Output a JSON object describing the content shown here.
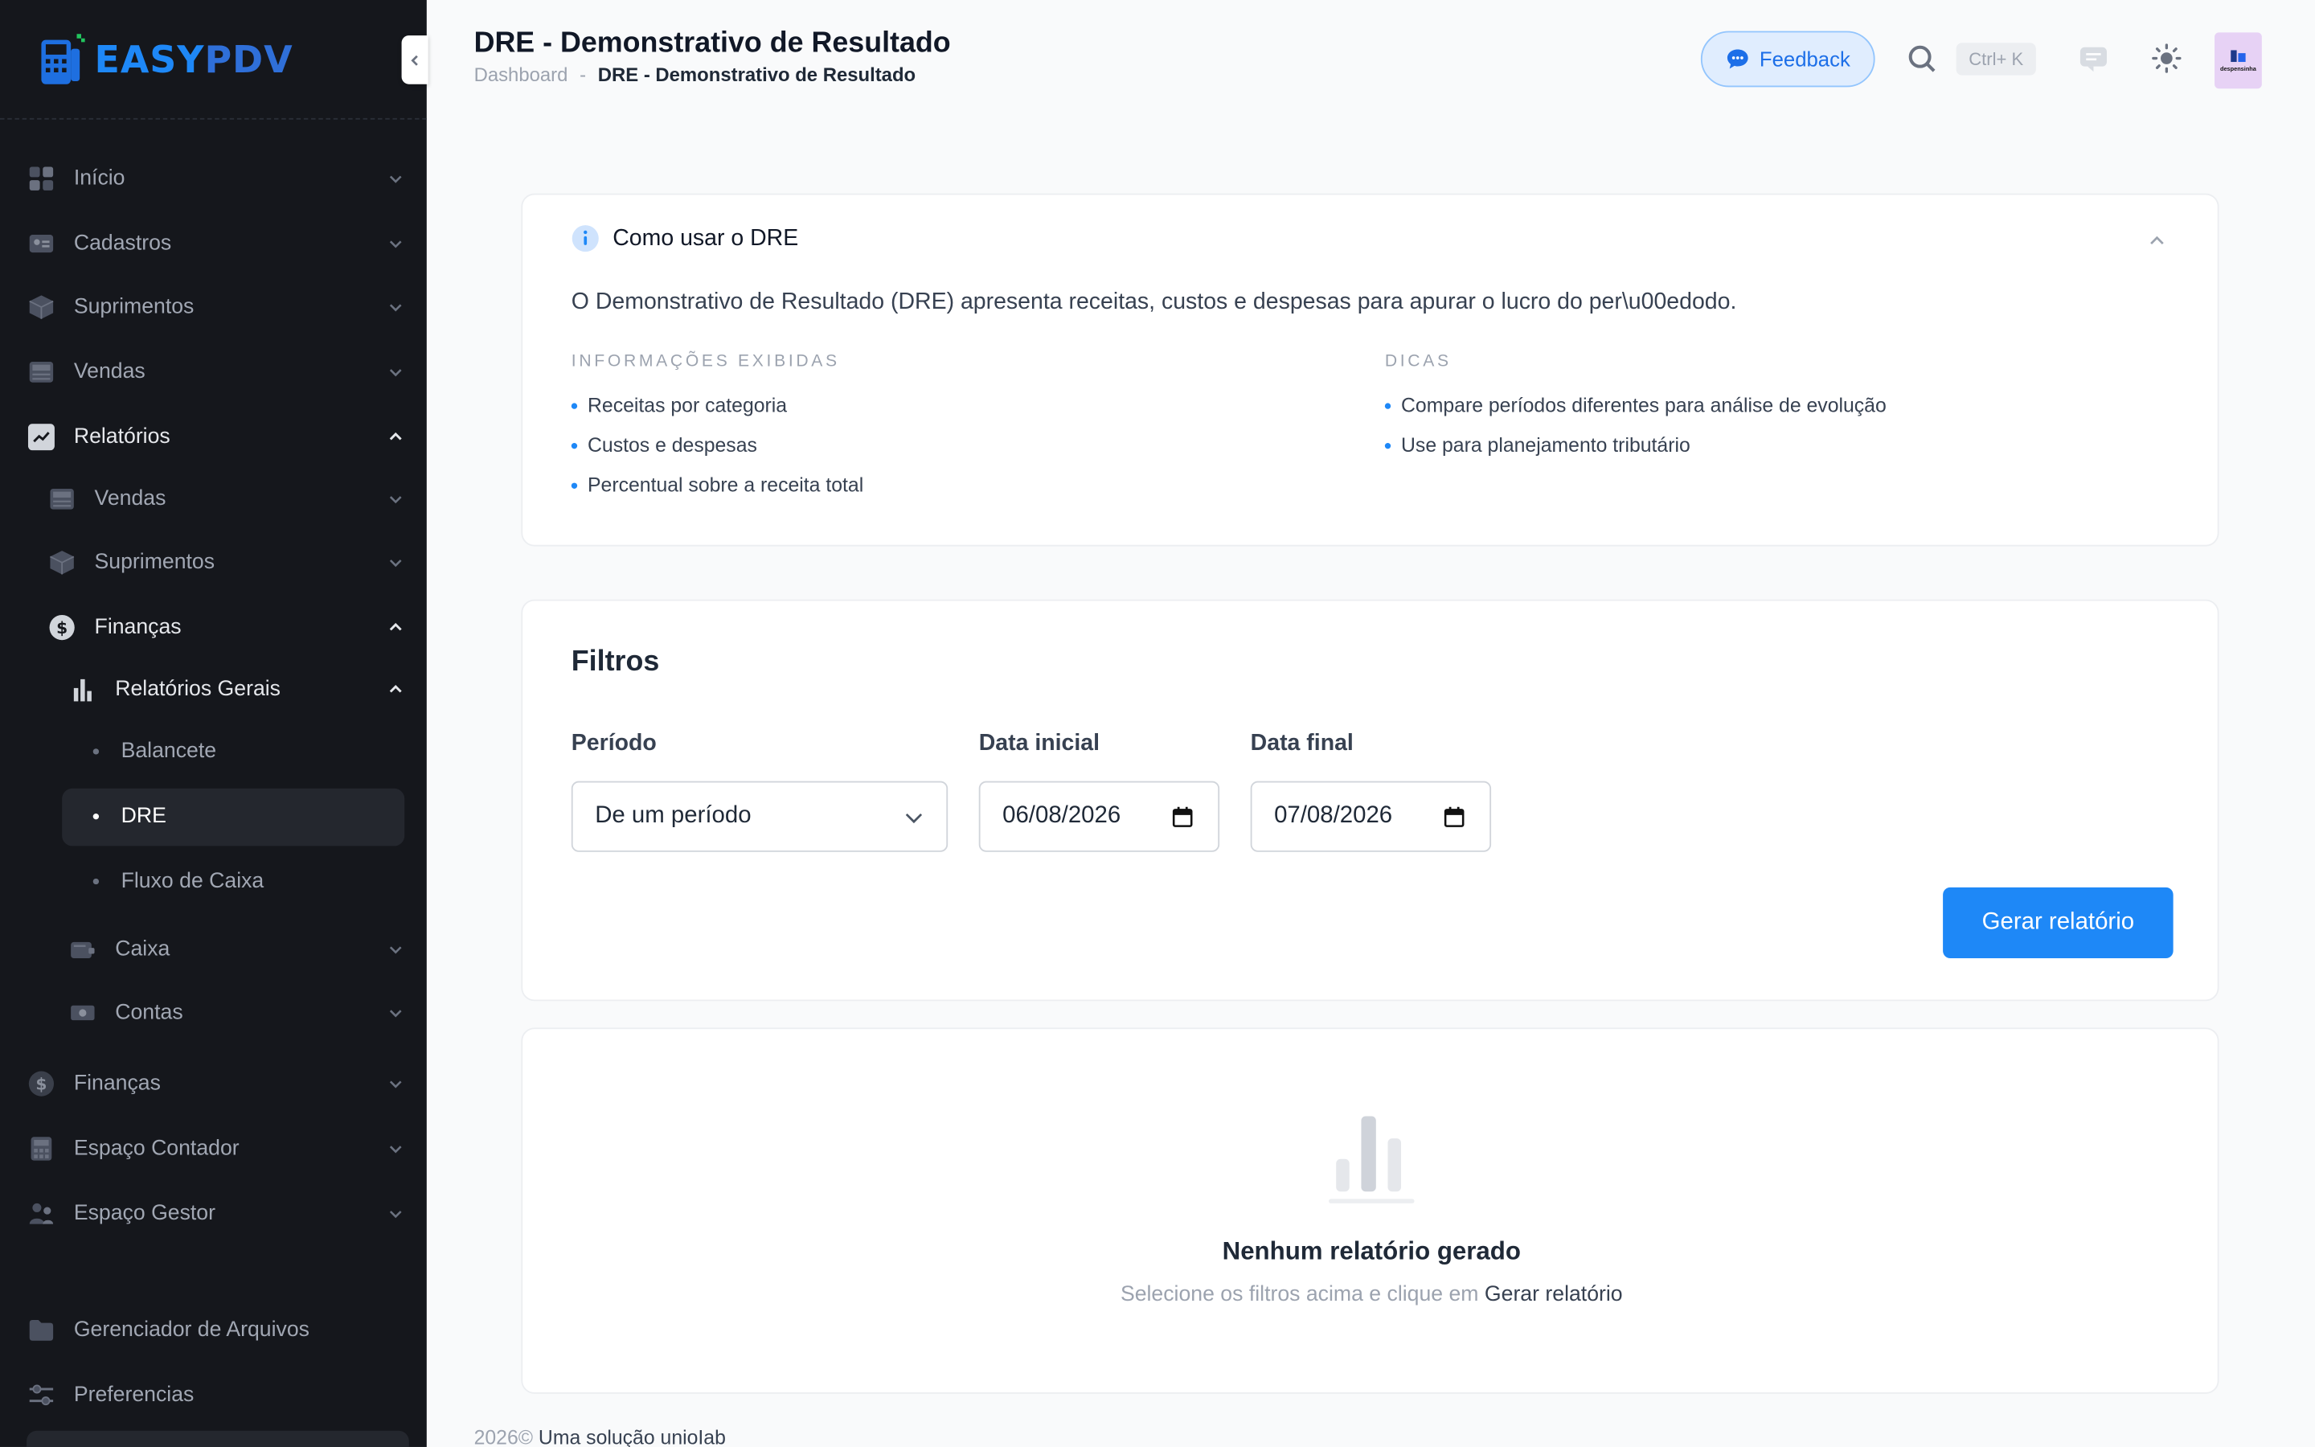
{
  "brand": {
    "logo_prefix": "EASY",
    "logo_suffix": "PDV"
  },
  "sidebar": {
    "items": [
      {
        "label": "Início",
        "icon": "grid-icon"
      },
      {
        "label": "Cadastros",
        "icon": "id-card-icon"
      },
      {
        "label": "Suprimentos",
        "icon": "box-icon"
      },
      {
        "label": "Vendas",
        "icon": "register-icon"
      },
      {
        "label": "Relatórios",
        "icon": "chart-line-icon",
        "expanded": true
      },
      {
        "label": "Vendas",
        "icon": "register-icon"
      },
      {
        "label": "Suprimentos",
        "icon": "box-icon"
      },
      {
        "label": "Finanças",
        "icon": "dollar-icon",
        "expanded": true
      },
      {
        "label": "Relatórios Gerais",
        "icon": "bar-chart-icon",
        "expanded": true
      },
      {
        "label": "Balancete"
      },
      {
        "label": "DRE",
        "active": true
      },
      {
        "label": "Fluxo de Caixa"
      },
      {
        "label": "Caixa",
        "icon": "cash-drawer-icon"
      },
      {
        "label": "Contas",
        "icon": "banknote-icon"
      },
      {
        "label": "Finanças",
        "icon": "dollar-icon"
      },
      {
        "label": "Espaço Contador",
        "icon": "calculator-icon"
      },
      {
        "label": "Espaço Gestor",
        "icon": "users-icon"
      },
      {
        "label": "Gerenciador de Arquivos",
        "icon": "folder-icon"
      },
      {
        "label": "Preferencias",
        "icon": "sliders-icon"
      }
    ]
  },
  "header": {
    "title": "DRE - Demonstrativo de Resultado",
    "breadcrumb_home": "Dashboard",
    "breadcrumb_sep": "-",
    "breadcrumb_current": "DRE - Demonstrativo de Resultado",
    "feedback_label": "Feedback",
    "shortcut_label": "Ctrl+ K",
    "avatar_text": "despensinha"
  },
  "help": {
    "title": "Como usar o DRE",
    "description": "O Demonstrativo de Resultado (DRE) apresenta receitas, custos e despesas para apurar o lucro do per\\u00edodo.",
    "info_title": "INFORMAÇÕES EXIBIDAS",
    "info_items": [
      "Receitas por categoria",
      "Custos e despesas",
      "Percentual sobre a receita total"
    ],
    "tips_title": "DICAS",
    "tips_items": [
      "Compare períodos diferentes para análise de evolução",
      "Use para planejamento tributário"
    ]
  },
  "filters": {
    "title": "Filtros",
    "period_label": "Período",
    "period_value": "De um período",
    "start_label": "Data inicial",
    "start_value": "06/08/2026",
    "end_label": "Data final",
    "end_value": "07/08/2026",
    "generate_label": "Gerar relatório"
  },
  "empty": {
    "title": "Nenhum relatório gerado",
    "subtitle_prefix": "Selecione os filtros acima e clique em",
    "subtitle_link": "Gerar relatório"
  },
  "footer": {
    "year": "2026©",
    "text": "Uma solução unioIab"
  },
  "colors": {
    "primary": "#1e88f7",
    "sidebar_bg": "#15171c",
    "page_bg": "#f9fafb"
  }
}
